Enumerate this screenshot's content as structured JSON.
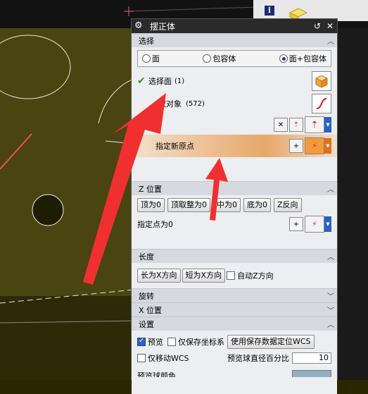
{
  "dialog": {
    "title": "摆正体"
  },
  "sections": {
    "select": {
      "header": "选择",
      "radios": [
        "面",
        "包容体",
        "面+包容体"
      ],
      "selected_radio": 2,
      "select_face_label": "选择面",
      "select_face_count": "(1)",
      "other_objects_label": "取对象",
      "other_objects_count": "(572)",
      "new_origin_label": "指定新原点"
    },
    "z_position": {
      "header": "Z 位置",
      "buttons": [
        "顶为0",
        "顶取整为0",
        "中为0",
        "底为0",
        "Z反向"
      ],
      "point_label": "指定点为0"
    },
    "length": {
      "header": "长度",
      "buttons": [
        "长为X方向",
        "短为X方向"
      ],
      "auto_z_label": "自动Z方向"
    },
    "rotate": {
      "header": "旋转"
    },
    "x_position": {
      "header": "X 位置"
    },
    "settings": {
      "header": "设置",
      "preview_label": "预览",
      "save_coords_label": "仅保存坐标系",
      "use_saved_button": "使用保存数据定位WCS",
      "move_wcs_label": "仅移动WCS",
      "ball_pct_label": "预览球直径百分比",
      "ball_pct_value": "10",
      "partial_label": "预览球颜色"
    }
  },
  "colors": {
    "dialog_bg": "#e0e2e6",
    "titlebar": "#2a2a2a",
    "arrow_red": "#f03030",
    "model": "#4a4410",
    "highlight": "#e7a76a"
  },
  "icons": [
    "settings-icon",
    "reset-icon",
    "close-icon",
    "checkmark-icon",
    "cube-icon",
    "curve-icon",
    "vector-icon",
    "point-icon",
    "info-icon"
  ]
}
